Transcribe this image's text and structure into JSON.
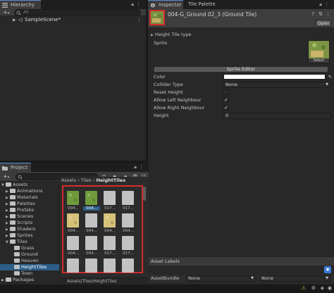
{
  "hierarchy": {
    "tab": "Hierarchy",
    "add": "+",
    "add_caret": "▾",
    "search_placeholder": "All",
    "scene": "SampleScene*"
  },
  "inspector": {
    "tabs": [
      "Inspector",
      "Tile Palette"
    ],
    "asset_title": "004-G_Ground 02_3 (Ground Tile)",
    "open_button": "Open",
    "section_title": "Height Tile type",
    "sprite_label": "Sprite",
    "sprite_select": "Select",
    "sprite_editor": "Sprite Editor",
    "props": {
      "color": "Color",
      "collider_type": "Collider Type",
      "collider_value": "None",
      "reset_height": "Reset Height",
      "allow_left": "Allow Left Neighbour",
      "allow_right": "Allow Right Neighbour",
      "height": "Height",
      "height_value": "0"
    },
    "checks": {
      "reset_height": false,
      "allow_left": true,
      "allow_right": true
    },
    "asset_labels": "Asset Labels",
    "asset_bundle": "AssetBundle",
    "bundle_value": "None",
    "variant_value": "None"
  },
  "project": {
    "tab": "Project",
    "add": "+",
    "add_caret": "▾",
    "count_badge": "15",
    "breadcrumb": [
      "Assets",
      "Tiles",
      "HeightTiles"
    ],
    "tree": [
      {
        "label": "Assets",
        "depth": 0,
        "expanded": true
      },
      {
        "label": "Animations",
        "depth": 1
      },
      {
        "label": "Materials",
        "depth": 1
      },
      {
        "label": "Palettes",
        "depth": 1
      },
      {
        "label": "Prefabs",
        "depth": 1
      },
      {
        "label": "Scenes",
        "depth": 1
      },
      {
        "label": "Scripts",
        "depth": 1
      },
      {
        "label": "Shaders",
        "depth": 1
      },
      {
        "label": "Sprites",
        "depth": 1
      },
      {
        "label": "Tiles",
        "depth": 1,
        "expanded": true
      },
      {
        "label": "Grass",
        "depth": 2
      },
      {
        "label": "Ground",
        "depth": 2
      },
      {
        "label": "Heaven",
        "depth": 2
      },
      {
        "label": "HeightTiles",
        "depth": 2,
        "selected": true
      },
      {
        "label": "Town",
        "depth": 2
      },
      {
        "label": "Packages",
        "depth": 0
      }
    ],
    "tiles": [
      {
        "label": "004...",
        "kind": "grass"
      },
      {
        "label": "004...",
        "kind": "grass",
        "selected": true
      },
      {
        "label": "017...",
        "kind": "grey"
      },
      {
        "label": "017...",
        "kind": "grey"
      },
      {
        "label": "004...",
        "kind": "ground"
      },
      {
        "label": "004...",
        "kind": "grey"
      },
      {
        "label": "004...",
        "kind": "ground"
      },
      {
        "label": "004...",
        "kind": "grey"
      },
      {
        "label": "004...",
        "kind": "grey"
      },
      {
        "label": "004...",
        "kind": "grey"
      },
      {
        "label": "017...",
        "kind": "grey"
      },
      {
        "label": "017...",
        "kind": "grey"
      },
      {
        "label": "",
        "kind": "grey"
      },
      {
        "label": "",
        "kind": "grey"
      },
      {
        "label": "",
        "kind": "grey"
      },
      {
        "label": "",
        "kind": "grey"
      }
    ],
    "path": "Assets/Tiles/HeightTiles"
  },
  "colors": {
    "accent": "#2c5d87",
    "highlight_red": "#d62b2b",
    "grass": "#6f9b3b",
    "ground": "#d6c179"
  }
}
